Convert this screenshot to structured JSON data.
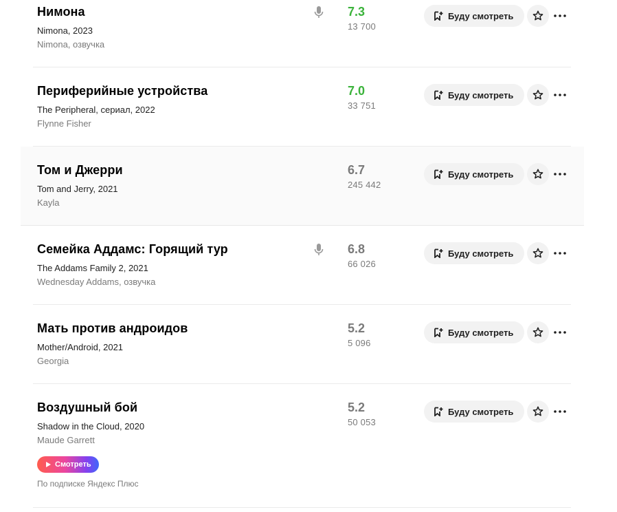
{
  "buttons": {
    "watchlist_label": "Буду смотреть",
    "watch_pill_label": "Смотреть"
  },
  "colors": {
    "rating_high": "#3bb33b",
    "rating_neutral": "#7a7a7a",
    "pill_gradient": [
      "#ff5c4d",
      "#eb469f",
      "#8341ef",
      "#3f68f9"
    ]
  },
  "films": [
    {
      "title": "Нимона",
      "original": "Nimona, 2023",
      "role": "Nimona, озвучка",
      "voice_icon": "microphone-icon",
      "rating": "7.3",
      "votes": "13 700"
    },
    {
      "title": "Периферийные устройства",
      "original": "The Peripheral, сериал, 2022",
      "role": "Flynne Fisher",
      "rating": "7.0",
      "votes": "33 751"
    },
    {
      "title": "Том и Джерри",
      "original": "Tom and Jerry, 2021",
      "role": "Kayla",
      "rating": "6.7",
      "votes": "245 442"
    },
    {
      "title": "Семейка Аддамс: Горящий тур",
      "original": "The Addams Family 2, 2021",
      "role": "Wednesday Addams, озвучка",
      "voice_icon": "microphone-icon",
      "rating": "6.8",
      "votes": "66 026"
    },
    {
      "title": "Мать против андроидов",
      "original": "Mother/Android, 2021",
      "role": "Georgia",
      "rating": "5.2",
      "votes": "5 096"
    },
    {
      "title": "Воздушный бой",
      "original": "Shadow in the Cloud, 2020",
      "role": "Maude Garrett",
      "rating": "5.2",
      "votes": "50 053",
      "subscription_note": "По подписке Яндекс Плюс"
    }
  ]
}
